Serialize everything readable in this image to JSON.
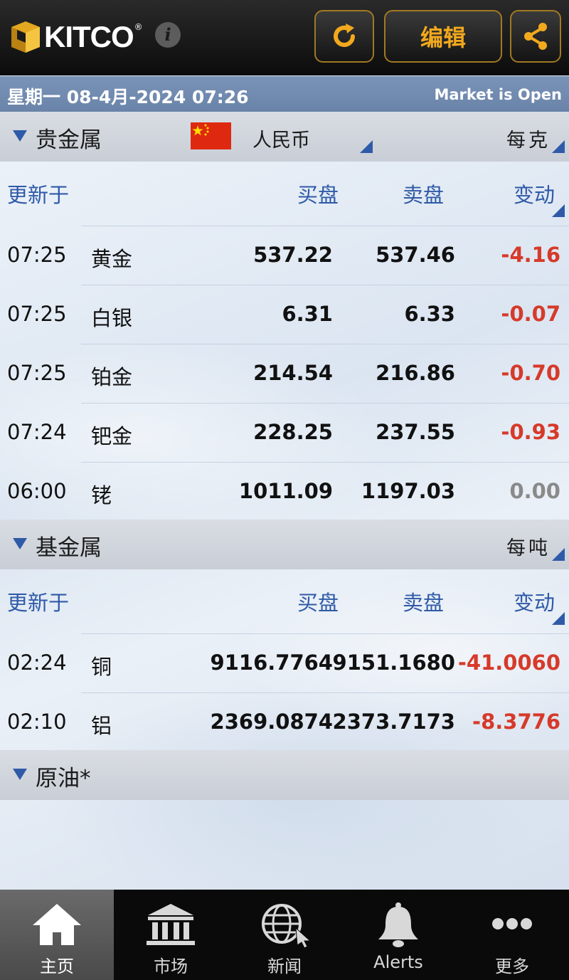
{
  "header": {
    "logo_text": "KITCO",
    "logo_reg": "®",
    "info_label": "i",
    "edit_label": "编辑"
  },
  "status": {
    "date": "星期一 08-4月-2024 07:26",
    "market": "Market is Open"
  },
  "precious": {
    "title": "贵金属",
    "currency": "人民币",
    "unit": "每克",
    "headers": {
      "updated": "更新于",
      "bid": "买盘",
      "ask": "卖盘",
      "change": "变动"
    },
    "rows": [
      {
        "time": "07:25",
        "name": "黄金",
        "bid": "537.22",
        "ask": "537.46",
        "change": "-4.16"
      },
      {
        "time": "07:25",
        "name": "白银",
        "bid": "6.31",
        "ask": "6.33",
        "change": "-0.07"
      },
      {
        "time": "07:25",
        "name": "铂金",
        "bid": "214.54",
        "ask": "216.86",
        "change": "-0.70"
      },
      {
        "time": "07:24",
        "name": "钯金",
        "bid": "228.25",
        "ask": "237.55",
        "change": "-0.93"
      },
      {
        "time": "06:00",
        "name": "铑",
        "bid": "1011.09",
        "ask": "1197.03",
        "change": "0.00"
      }
    ]
  },
  "base": {
    "title": "基金属",
    "unit": "每吨",
    "headers": {
      "updated": "更新于",
      "bid": "买盘",
      "ask": "卖盘",
      "change": "变动"
    },
    "rows": [
      {
        "time": "02:24",
        "name": "铜",
        "bid": "9116.7764",
        "ask": "9151.1680",
        "change": "-41.0060"
      },
      {
        "time": "02:10",
        "name": "铝",
        "bid": "2369.0874",
        "ask": "2373.7173",
        "change": "-8.3776"
      }
    ]
  },
  "oil": {
    "title": "原油*"
  },
  "tabs": [
    {
      "label": "主页",
      "icon": "home-icon"
    },
    {
      "label": "市场",
      "icon": "bank-icon"
    },
    {
      "label": "新闻",
      "icon": "globe-icon"
    },
    {
      "label": "Alerts",
      "icon": "bell-icon"
    },
    {
      "label": "更多",
      "icon": "more-icon"
    }
  ],
  "colors": {
    "accent_orange": "#f2a91e",
    "header_blue": "#2f5aa8",
    "negative_red": "#d63a2a",
    "flag_red": "#de2910",
    "flag_star": "#ffde00"
  }
}
